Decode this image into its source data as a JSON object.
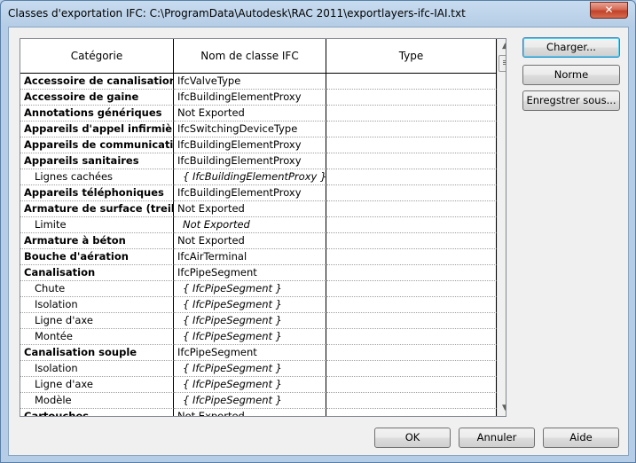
{
  "window": {
    "title": "Classes d'exportation IFC: C:\\ProgramData\\Autodesk\\RAC 2011\\exportlayers-ifc-IAI.txt",
    "close_glyph": "✕"
  },
  "table": {
    "headers": [
      "Catégorie",
      "Nom de classe IFC",
      "Type"
    ],
    "rows": [
      {
        "kind": "group",
        "category": "Accessoire de canalisation",
        "ifc": "IfcValveType",
        "type": ""
      },
      {
        "kind": "group",
        "category": "Accessoire de gaine",
        "ifc": "IfcBuildingElementProxy",
        "type": ""
      },
      {
        "kind": "group",
        "category": "Annotations génériques",
        "ifc": "Not Exported",
        "type": ""
      },
      {
        "kind": "group",
        "category": "Appareils d'appel infirmières",
        "ifc": "IfcSwitchingDeviceType",
        "type": ""
      },
      {
        "kind": "group",
        "category": "Appareils de communication",
        "ifc": "IfcBuildingElementProxy",
        "type": ""
      },
      {
        "kind": "group",
        "category": "Appareils sanitaires",
        "ifc": "IfcBuildingElementProxy",
        "type": ""
      },
      {
        "kind": "child",
        "category": "Lignes cachées",
        "ifc": "{ IfcBuildingElementProxy }",
        "type": ""
      },
      {
        "kind": "group",
        "category": "Appareils téléphoniques",
        "ifc": "IfcBuildingElementProxy",
        "type": ""
      },
      {
        "kind": "group",
        "category": "Armature de surface (treillis)",
        "ifc": "Not Exported",
        "type": ""
      },
      {
        "kind": "child",
        "category": "Limite",
        "ifc": "Not Exported",
        "type": ""
      },
      {
        "kind": "group",
        "category": "Armature à béton",
        "ifc": "Not Exported",
        "type": ""
      },
      {
        "kind": "group",
        "category": "Bouche d'aération",
        "ifc": "IfcAirTerminal",
        "type": ""
      },
      {
        "kind": "group",
        "category": "Canalisation",
        "ifc": "IfcPipeSegment",
        "type": ""
      },
      {
        "kind": "child",
        "category": "Chute",
        "ifc": "{ IfcPipeSegment }",
        "type": ""
      },
      {
        "kind": "child",
        "category": "Isolation",
        "ifc": "{ IfcPipeSegment }",
        "type": ""
      },
      {
        "kind": "child",
        "category": "Ligne d'axe",
        "ifc": "{ IfcPipeSegment }",
        "type": ""
      },
      {
        "kind": "child",
        "category": "Montée",
        "ifc": "{ IfcPipeSegment }",
        "type": ""
      },
      {
        "kind": "group",
        "category": "Canalisation souple",
        "ifc": "IfcPipeSegment",
        "type": ""
      },
      {
        "kind": "child",
        "category": "Isolation",
        "ifc": "{ IfcPipeSegment }",
        "type": ""
      },
      {
        "kind": "child",
        "category": "Ligne d'axe",
        "ifc": "{ IfcPipeSegment }",
        "type": ""
      },
      {
        "kind": "child",
        "category": "Modèle",
        "ifc": "{ IfcPipeSegment }",
        "type": ""
      },
      {
        "kind": "group",
        "category": "Cartouches",
        "ifc": "Not Exported",
        "type": ""
      }
    ]
  },
  "side_buttons": {
    "load": "Charger...",
    "standard": "Norme",
    "save_as": "Enregstrer sous..."
  },
  "footer_buttons": {
    "ok": "OK",
    "cancel": "Annuler",
    "help": "Aide"
  },
  "scrollbar": {
    "up_glyph": "▲",
    "down_glyph": "▼"
  }
}
